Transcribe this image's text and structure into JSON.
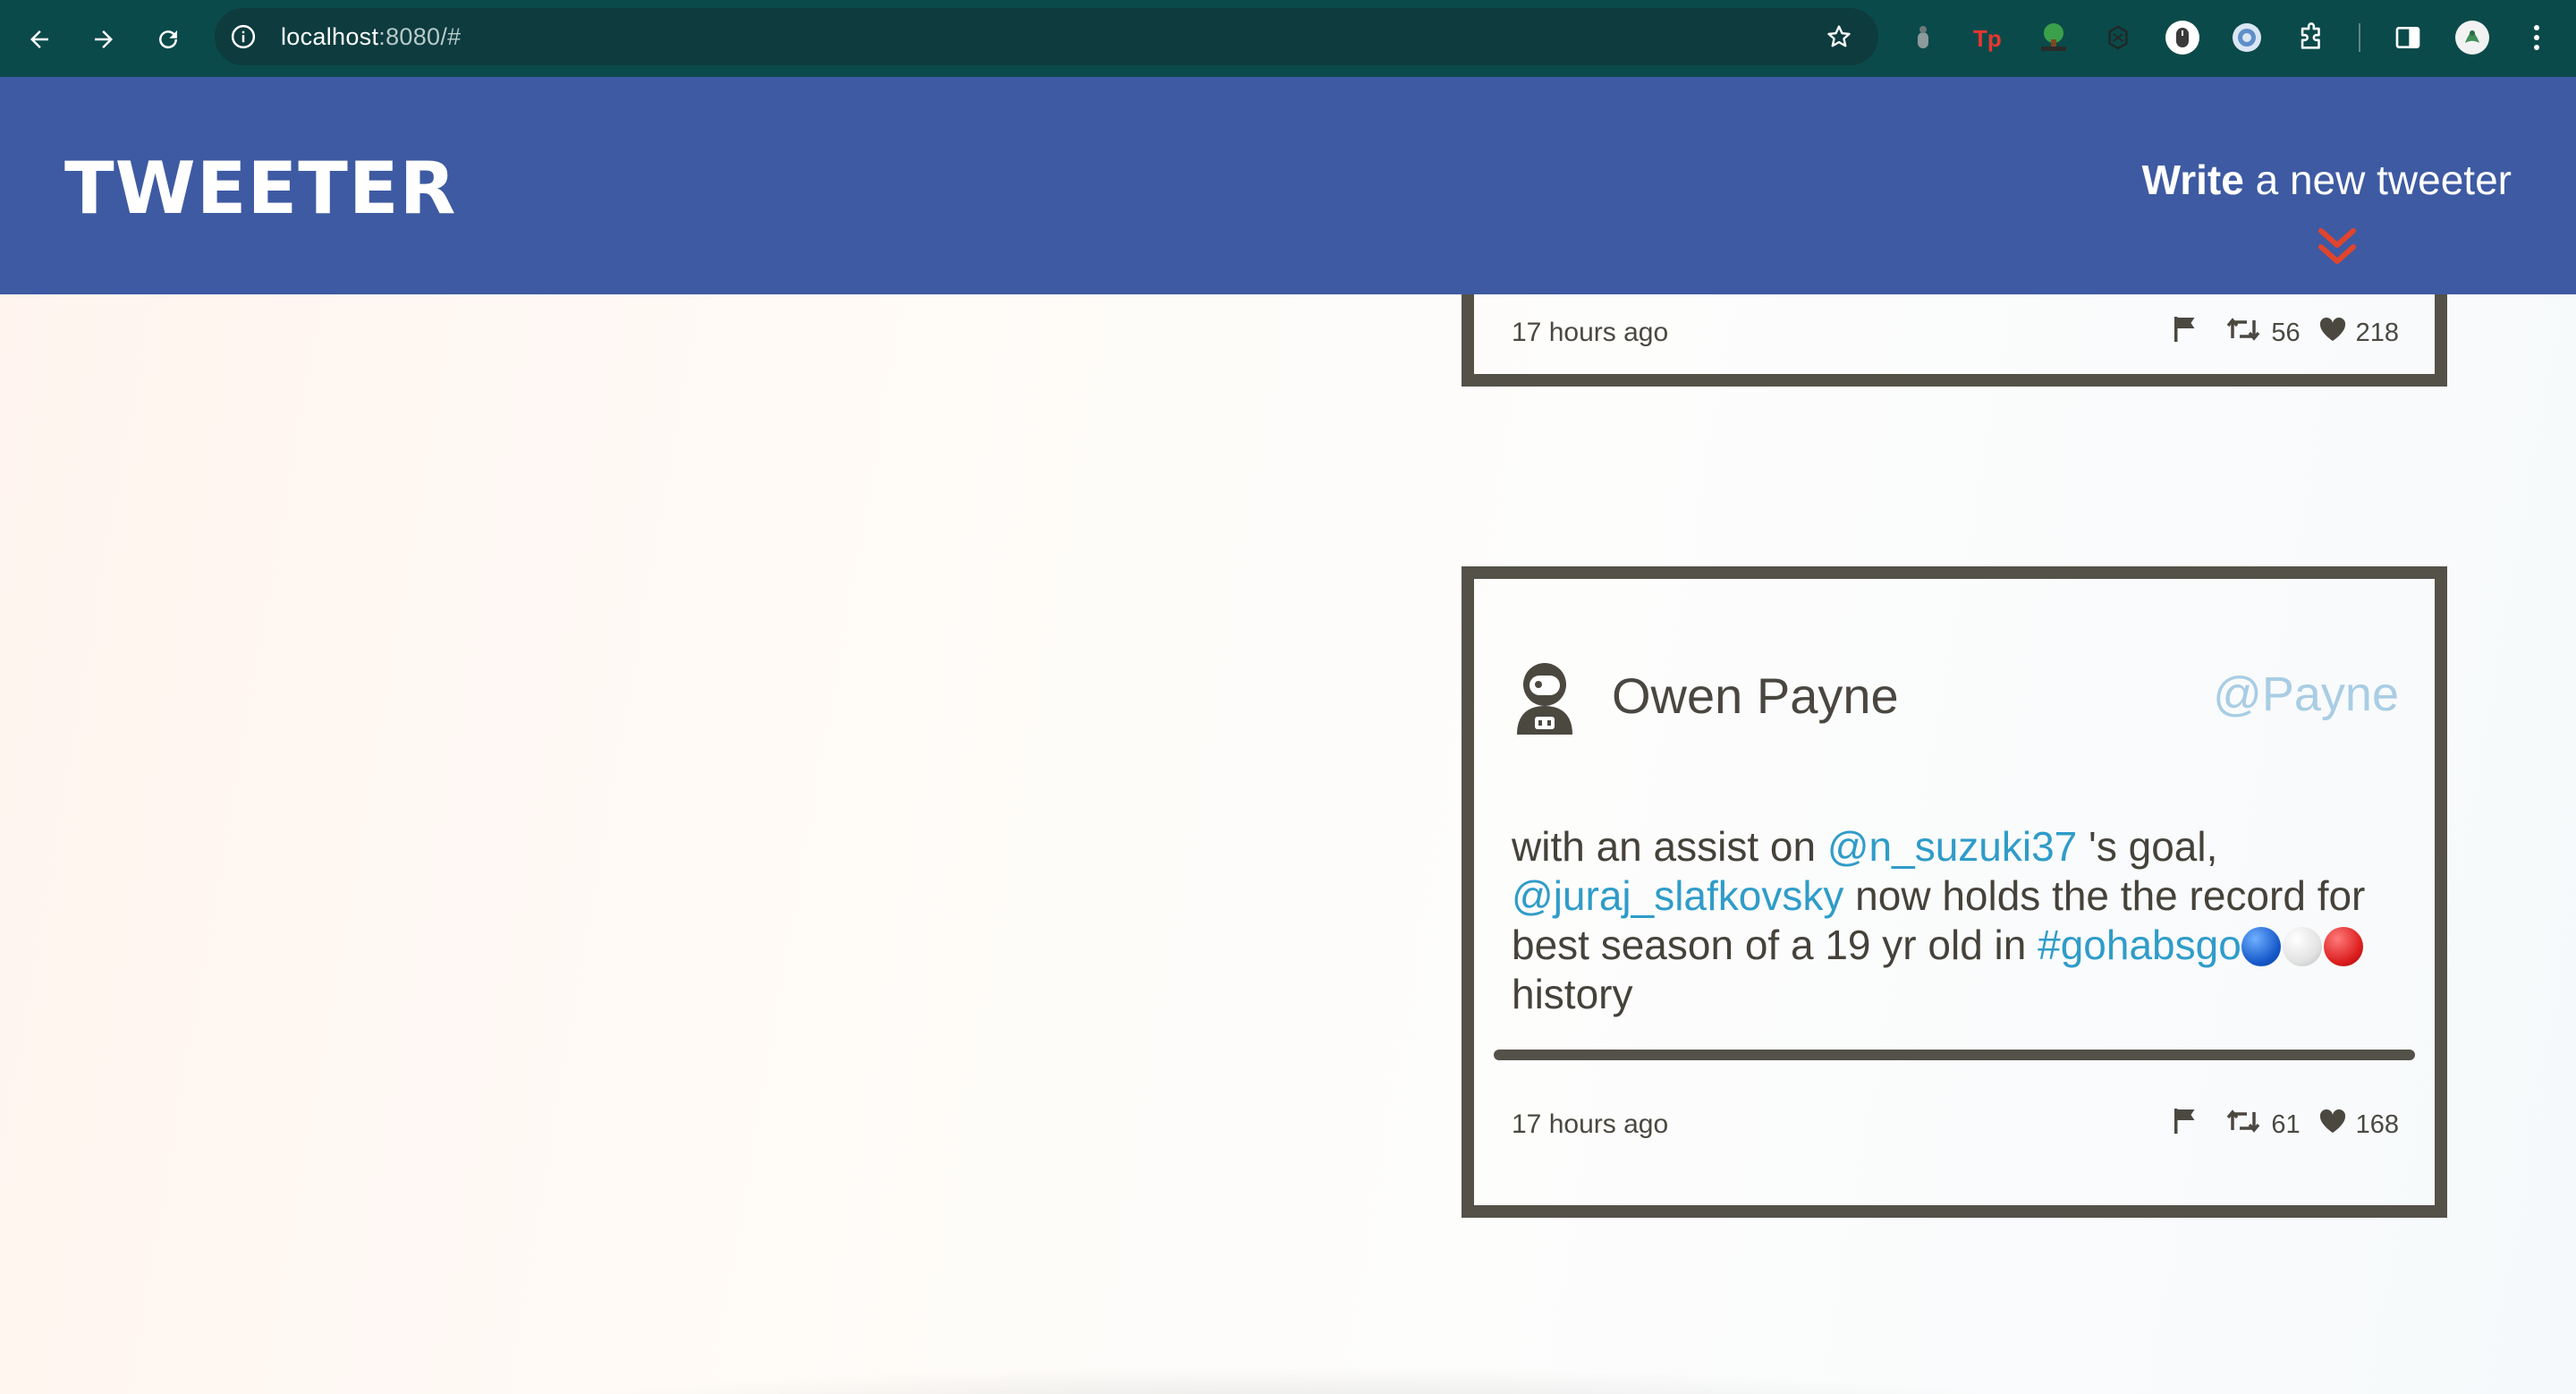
{
  "browser": {
    "url_host": "localhost",
    "url_path": ":8080/#",
    "icons": [
      "back-icon",
      "forward-icon",
      "reload-icon",
      "site-info-icon",
      "bookmark-star-icon",
      "extension-icons",
      "puzzle-icon",
      "side-panel-icon",
      "profile-avatar",
      "menu-icon"
    ]
  },
  "app": {
    "brand": "TWEETER",
    "write_bold": "Write",
    "write_rest": " a new tweeter",
    "accent": "#3e5aa2",
    "chevron_color": "#e0452c"
  },
  "tweets": [
    {
      "timestamp": "17 hours ago",
      "retweets": "56",
      "likes": "218"
    },
    {
      "name": "Owen Payne",
      "handle": "@Payne",
      "text_parts": {
        "t1": "with an assist on ",
        "m1": "@n_suzuki37",
        "t2": " 's goal, ",
        "m2": "@juraj_slafkovsky",
        "t3": " now holds the the record for best season of a 19 yr old in ",
        "h1": "#gohabsgo",
        "t4": " history"
      },
      "timestamp": "17 hours ago",
      "retweets": "61",
      "likes": "168"
    }
  ]
}
